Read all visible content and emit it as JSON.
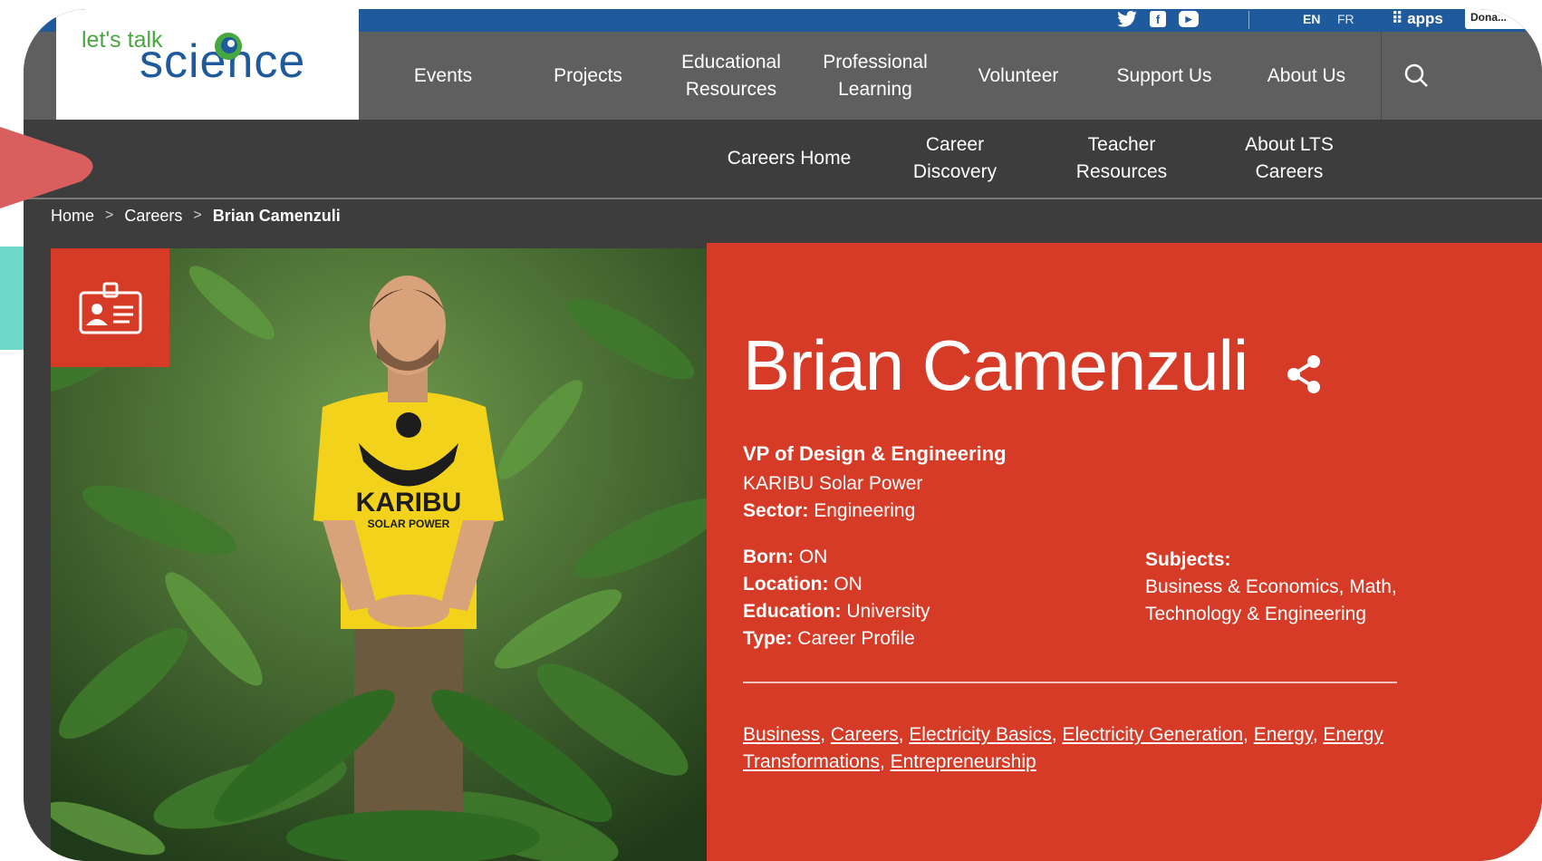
{
  "brand": {
    "logo_small": "let's talk",
    "logo_big": "science",
    "colors": {
      "blue": "#1f5a9c",
      "green": "#47a83f",
      "red": "#d63b27",
      "dark": "#3d3d3d",
      "nav": "#5f5f5f"
    }
  },
  "topbar": {
    "social_icons": [
      "twitter-icon",
      "facebook-icon",
      "youtube-icon"
    ],
    "lang_en": "EN",
    "lang_fr": "FR",
    "apps_label": "apps",
    "donate_label": "Dona..."
  },
  "main_nav": [
    {
      "label": "Events"
    },
    {
      "label": "Projects"
    },
    {
      "label": "Educational Resources"
    },
    {
      "label": "Professional Learning"
    },
    {
      "label": "Volunteer"
    },
    {
      "label": "Support Us"
    },
    {
      "label": "About Us"
    }
  ],
  "sub_nav": [
    {
      "label": "Careers Home"
    },
    {
      "label": "Career Discovery"
    },
    {
      "label": "Teacher Resources"
    },
    {
      "label": "About LTS Careers"
    }
  ],
  "breadcrumb": {
    "home": "Home",
    "careers": "Careers",
    "current": "Brian Camenzuli"
  },
  "profile": {
    "name": "Brian Camenzuli",
    "job_title": "VP of Design & Engineering",
    "company": "KARIBU Solar Power",
    "sector_label": "Sector:",
    "sector": "Engineering",
    "born_label": "Born:",
    "born": "ON",
    "location_label": "Location:",
    "location": "ON",
    "education_label": "Education:",
    "education": "University",
    "type_label": "Type:",
    "type": "Career Profile",
    "subjects_label": "Subjects:",
    "subjects_line1": "Business & Economics, Math,",
    "subjects_line2": "Technology & Engineering",
    "tags": [
      "Business",
      "Careers",
      "Electricity Basics",
      "Electricity Generation",
      "Energy",
      "Energy Transformations",
      "Entrepreneurship"
    ],
    "shirt_text": "KARIBU",
    "shirt_subtext": "SOLAR POWER"
  }
}
